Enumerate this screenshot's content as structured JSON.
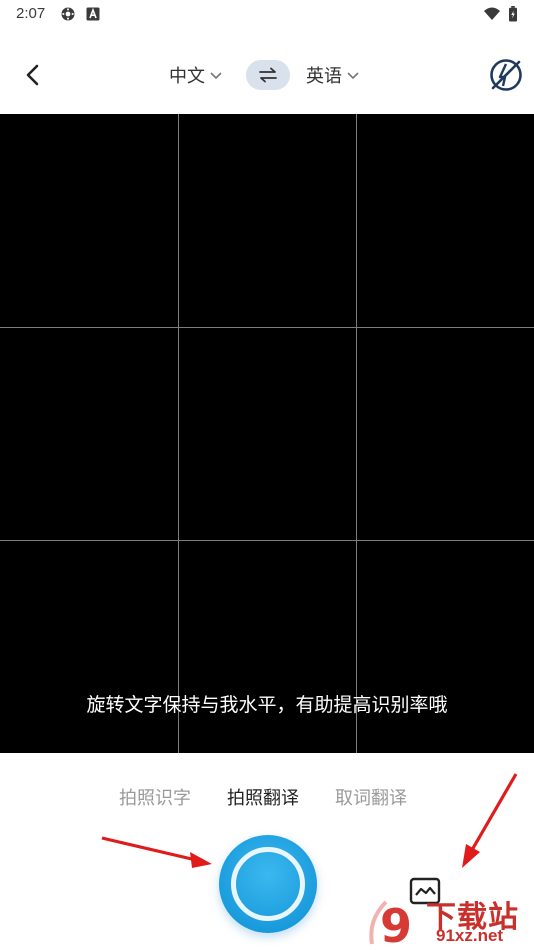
{
  "status_bar": {
    "time": "2:07",
    "icons": [
      "settings-gear-icon",
      "text-a-icon",
      "wifi-icon",
      "battery-charging-icon"
    ]
  },
  "header": {
    "back_icon": "chevron-left-icon",
    "source_lang": "中文",
    "target_lang": "英语",
    "swap_icon": "swap-arrows-icon",
    "flash_icon": "flash-off-icon"
  },
  "camera": {
    "hint": "旋转文字保持与我水平，有助提高识别率哦"
  },
  "modes": [
    {
      "label": "拍照识字",
      "active": false
    },
    {
      "label": "拍照翻译",
      "active": true
    },
    {
      "label": "取词翻译",
      "active": false
    }
  ],
  "controls": {
    "shutter_icon": "shutter-button",
    "gallery_icon": "gallery-image-icon"
  },
  "watermark": {
    "text": "下载站",
    "url": "91xz.net",
    "logo_text": "9"
  },
  "colors": {
    "accent": "#1aa2e6",
    "swap_bg": "#d9e1ec",
    "arrow": "#e01b1b",
    "watermark": "#c9302c"
  }
}
